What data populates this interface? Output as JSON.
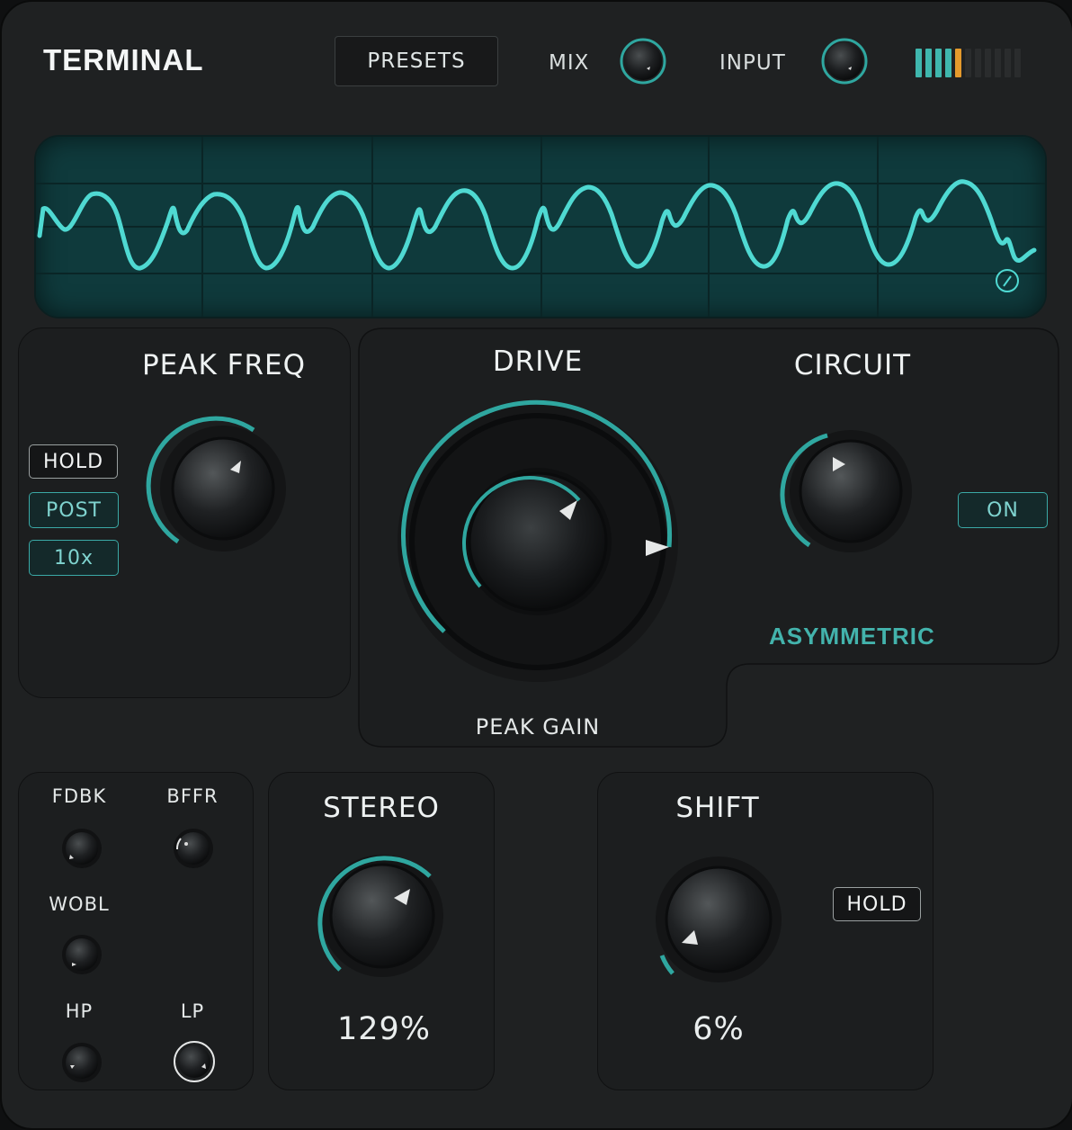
{
  "header": {
    "logo": "TERMINAL",
    "presets_label": "PRESETS",
    "mix_label": "MIX",
    "input_label": "INPUT",
    "meter": {
      "lit_segments": 5,
      "total_segments": 11,
      "colors": [
        "#3fb7ae",
        "#3fb7ae",
        "#3fb7ae",
        "#3fb7ae",
        "#e59a2c"
      ]
    }
  },
  "peak_freq": {
    "title": "PEAK FREQ",
    "hold_label": "HOLD",
    "post_label": "POST",
    "tenx_label": "10x"
  },
  "drive": {
    "title": "DRIVE",
    "sub_label": "PEAK GAIN"
  },
  "circuit": {
    "title": "CIRCUIT",
    "on_label": "ON",
    "mode_label": "ASYMMETRIC"
  },
  "mini": {
    "fdbk_label": "FDBK",
    "bffr_label": "BFFR",
    "wobl_label": "WOBL",
    "hp_label": "HP",
    "lp_label": "LP"
  },
  "stereo": {
    "title": "STEREO",
    "value": "129%"
  },
  "shift": {
    "title": "SHIFT",
    "hold_label": "HOLD",
    "value": "6%"
  },
  "colors": {
    "accent": "#3fb7ae",
    "meter_peak": "#e59a2c",
    "waveform": "#4fd9d2",
    "scope_bg": "#0f3a3c"
  }
}
